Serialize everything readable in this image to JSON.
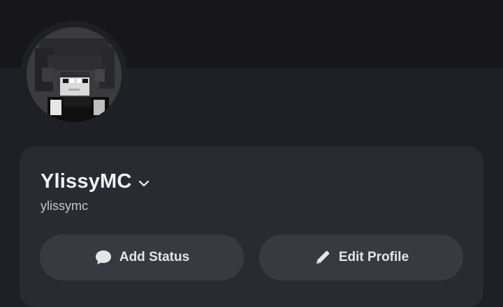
{
  "profile": {
    "display_name": "YlissyMC",
    "username": "ylissymc",
    "avatar_alt": "avatar"
  },
  "actions": {
    "add_status_label": "Add Status",
    "edit_profile_label": "Edit Profile"
  },
  "icons": {
    "chevron": "chevron-down-icon",
    "status": "speech-bubble-icon",
    "edit": "pencil-icon"
  },
  "colors": {
    "banner": "#17171a",
    "background": "#1f2025",
    "card": "#2a2b32",
    "button": "#383a41",
    "text_primary": "#f2f3f5",
    "text_secondary": "#c4c6cc"
  }
}
